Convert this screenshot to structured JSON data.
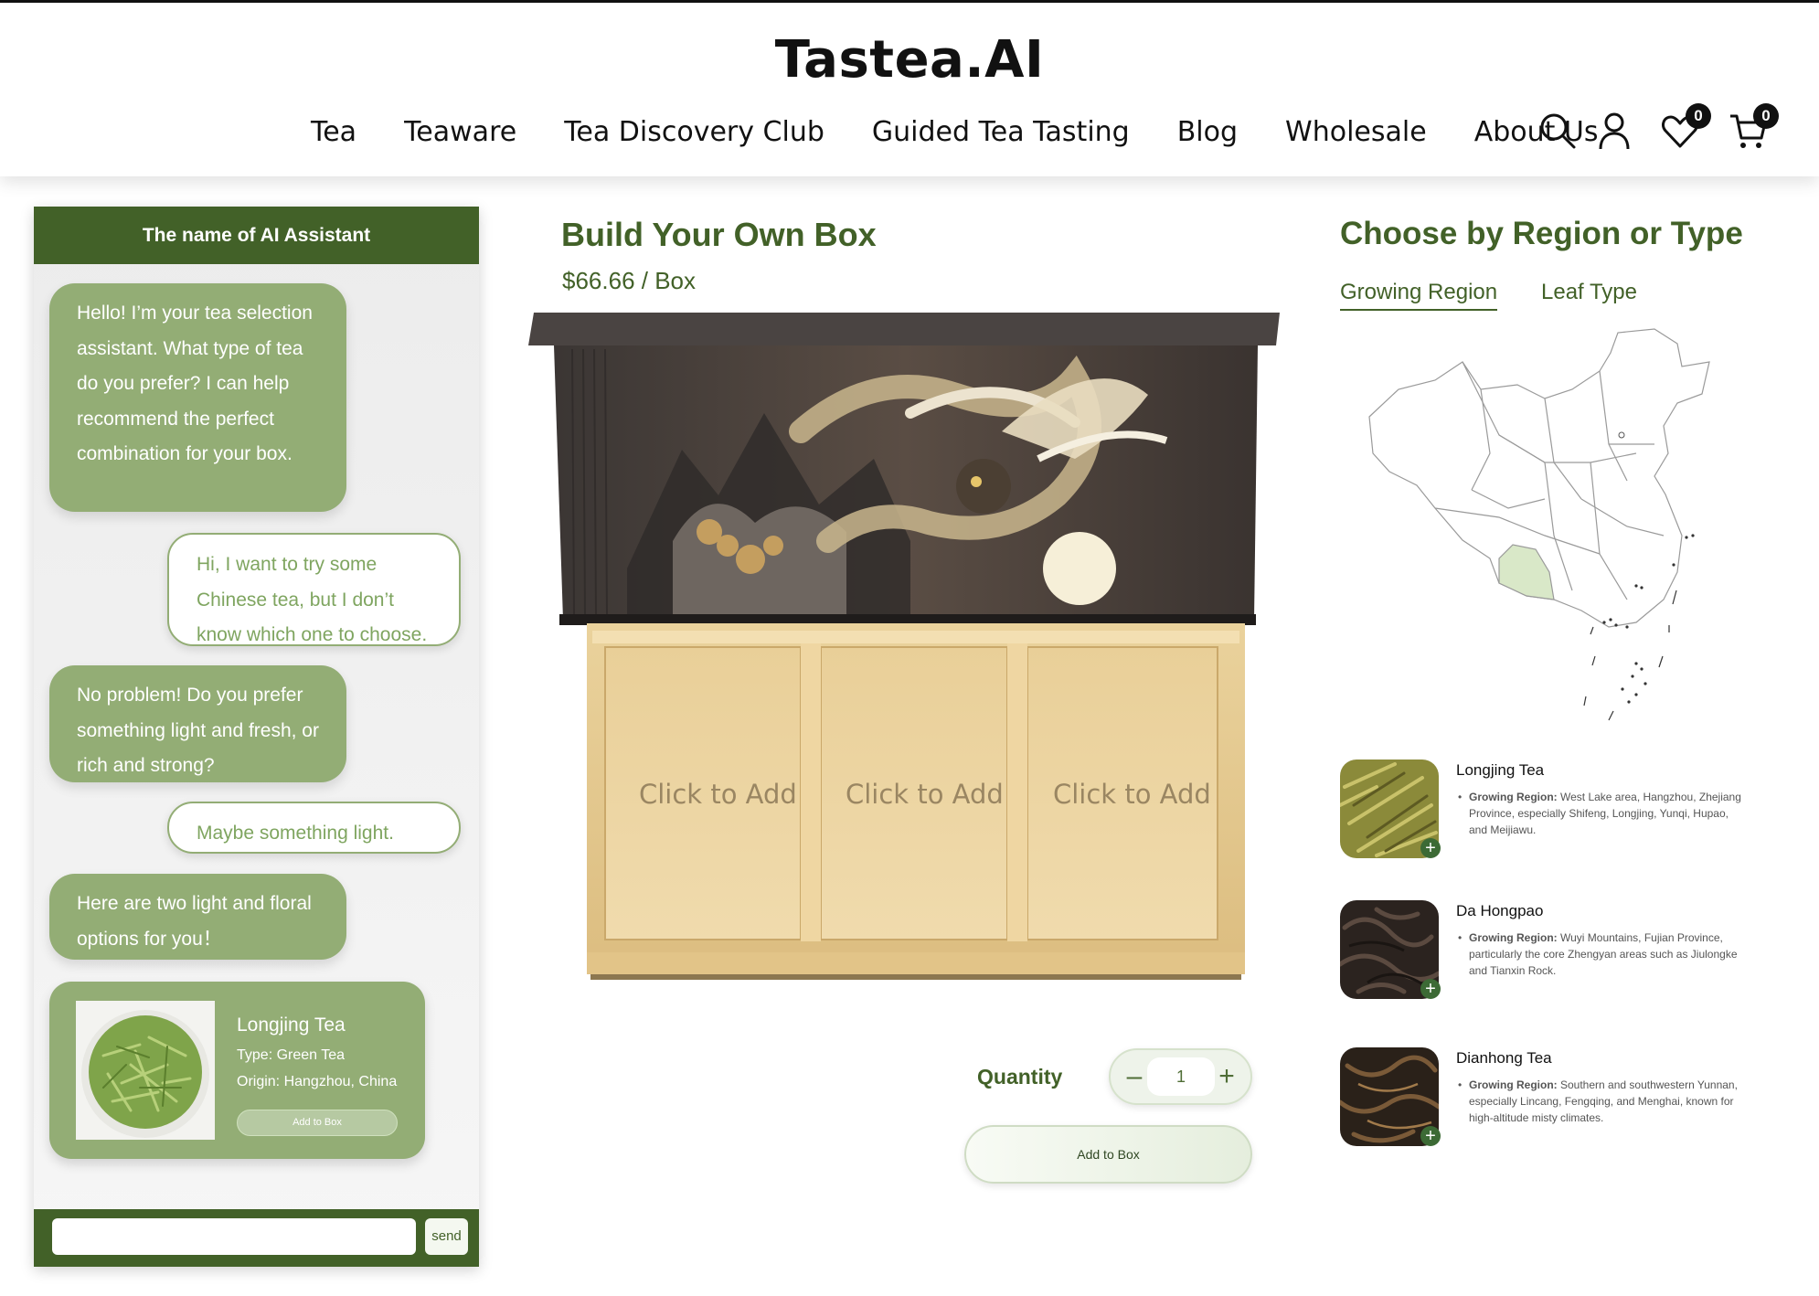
{
  "header": {
    "logo": "Tastea.AI",
    "nav": [
      "Tea",
      "Teaware",
      "Tea Discovery Club",
      "Guided Tea Tasting",
      "Blog",
      "Wholesale",
      "About Us"
    ],
    "wishlist_count": "0",
    "cart_count": "0"
  },
  "chat": {
    "title": "The name of AI Assistant",
    "messages": [
      {
        "from": "bot",
        "text": "Hello! I’m your tea selection assistant. What type of tea do you prefer? I can help recommend the perfect combination for your box."
      },
      {
        "from": "user",
        "text": "Hi, I want to try some Chinese tea, but I don’t know which one to choose."
      },
      {
        "from": "bot",
        "text": "No problem! Do you prefer something light and fresh, or rich and strong?"
      },
      {
        "from": "user",
        "text": "Maybe something light."
      },
      {
        "from": "bot",
        "text": "Here are two light and floral options for you！"
      }
    ],
    "card": {
      "name": "Longjing Tea",
      "type": "Type: Green Tea",
      "origin": "Origin: Hangzhou, China",
      "button": "Add to Box"
    },
    "send_label": "send"
  },
  "product": {
    "title": "Build Your Own Box",
    "price": "$66.66 / Box",
    "slots": [
      "Click to Add",
      "Click to Add",
      "Click to Add"
    ],
    "quantity_label": "Quantity",
    "quantity": "1",
    "add_button": "Add to Box"
  },
  "filter": {
    "title": "Choose by Region or Type",
    "tabs": [
      "Growing Region",
      "Leaf Type"
    ],
    "highlight_color": "#d9e8c8"
  },
  "teas": [
    {
      "name": "Longjing Tea",
      "label": "Growing Region:",
      "desc": "West Lake area, Hangzhou, Zhejiang Province, especially Shifeng, Longjing, Yunqi, Hupao, and Meijiawu."
    },
    {
      "name": "Da Hongpao",
      "label": "Growing Region:",
      "desc": "Wuyi Mountains, Fujian Province, particularly the core Zhengyan areas such as Jiulongke and Tianxin Rock."
    },
    {
      "name": "Dianhong Tea",
      "label": "Growing Region:",
      "desc": "Southern and southwestern Yunnan, especially Lincang, Fengqing, and Menghai, known for high-altitude misty climates."
    }
  ]
}
